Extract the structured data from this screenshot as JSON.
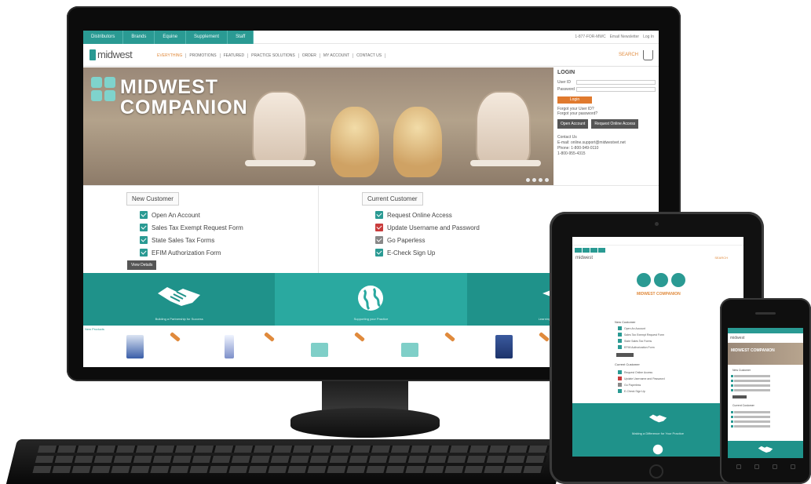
{
  "desktop": {
    "top_tabs": [
      "Distributors",
      "Brands",
      "Equine",
      "Supplement",
      "Staff"
    ],
    "top_links": [
      "1-877-FOR-MWC",
      "Email Newsletter",
      "Log In"
    ],
    "logo_text": "midwest",
    "main_nav": [
      "EVERYTHING",
      "PROMOTIONS",
      "FEATURED",
      "PRACTICE SOLUTIONS",
      "ORDER",
      "MY ACCOUNT",
      "CONTACT US"
    ],
    "search_label": "SEARCH",
    "hero": {
      "brand_line1": "MIDWEST",
      "brand_line2": "COMPANION"
    },
    "login": {
      "title": "LOGIN",
      "user_label": "User ID",
      "password_label": "Password",
      "submit_label": "Login",
      "forgot_user": "Forgot your User ID?",
      "forgot_password": "Forgot your password?",
      "open_account_label": "Open Account",
      "request_access_label": "Request Online Access",
      "contact_title": "Contact Us",
      "contact_email": "E-mail: online.support@midwestvet.net",
      "contact_phone": "Phone: 1-800-949-0110",
      "contact_fax": "1-800-955-4315"
    },
    "new_customer": {
      "heading": "New Customer",
      "items": [
        "Open An Account",
        "Sales Tax Exempt Request Form",
        "State Sales Tax Forms",
        "EFIM Authorization Form"
      ],
      "button_label": "View Details"
    },
    "current_customer": {
      "heading": "Current Customer",
      "items": [
        "Request Online Access",
        "Update Username and Password",
        "Go Paperless",
        "E-Check Sign Up"
      ]
    },
    "band_captions": [
      "Building a Partnership for Success",
      "Supporting your Practice",
      "Learning and Growth Opportunities"
    ],
    "products_label": "New Products"
  },
  "tablet": {
    "brand": "MIDWEST COMPANION",
    "new_customer_heading": "New Customer",
    "current_customer_heading": "Current Customer",
    "band_caption": "Making a Difference for Your Practice"
  },
  "phone": {
    "brand": "MIDWEST COMPANION",
    "new_customer_heading": "New Customer",
    "current_customer_heading": "Current Customer"
  },
  "colors": {
    "teal": "#2a9a93",
    "teal_light": "#2aa9a0",
    "orange": "#e08a3c",
    "dark_button": "#555555"
  }
}
